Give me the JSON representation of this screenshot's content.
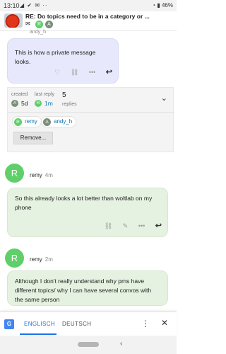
{
  "status_bar": {
    "time": "13:10",
    "icons": [
      "signal-icon",
      "check-icon",
      "mail-icon",
      "dots-icon"
    ],
    "battery": "46%"
  },
  "header": {
    "title": "RE: Do topics need to be in a category or ...",
    "chips": [
      "R",
      "A"
    ]
  },
  "top_message": {
    "username_fragment": "andy_h",
    "text": "This is how a private message looks."
  },
  "topic_map": {
    "created_label": "created",
    "created_avatar": "A",
    "created_value": "5d",
    "last_reply_label": "last reply",
    "last_reply_avatar": "R",
    "last_reply_value": "1m",
    "replies_count": "5",
    "replies_label": "replies",
    "participants": [
      {
        "initial": "R",
        "name": "remy",
        "color": "#5fcf6a"
      },
      {
        "initial": "A",
        "name": "andy_h",
        "color": "#7a8f7a"
      }
    ],
    "remove_label": "Remove..."
  },
  "posts": [
    {
      "avatar": "R",
      "username": "remy",
      "age": "4m",
      "text": "So this already looks a lot better than woltlab on my phone"
    },
    {
      "avatar": "R",
      "username": "remy",
      "age": "2m",
      "text": "Although I don't really understand why pms have different topics/ why I can have several convos with the same person"
    }
  ],
  "translate_bar": {
    "active_language": "ENGLISCH",
    "inactive_language": "DEUTSCH"
  },
  "colors": {
    "private_message_bg": "#e7e8fb",
    "post_bg": "#e5f2e1",
    "avatar_green": "#5fcf6a",
    "link_blue": "#0b76b5",
    "translate_blue": "#1a73e8"
  }
}
